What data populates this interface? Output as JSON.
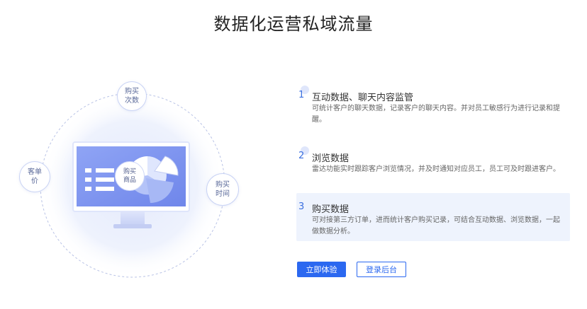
{
  "page": {
    "title": "数据化运营私域流量"
  },
  "illustration": {
    "bubble_top": "购买次数",
    "bubble_left": "客单价",
    "bubble_right": "购买时间",
    "center_label": "购买商品",
    "accent": "#7b95ef"
  },
  "steps": [
    {
      "num": "1",
      "title": "互动数据、聊天内容监管",
      "desc": "可统计客户的聊天数据，记录客户的聊天内容。并对员工敏感行为进行记录和提醒。"
    },
    {
      "num": "2",
      "title": "浏览数据",
      "desc": "雷达功能实时跟踪客户浏览情况，并及时通知对应员工，员工可及时跟进客户。"
    },
    {
      "num": "3",
      "title": "购买数据",
      "desc": "可对接第三方订单，进而统计客户购买记录，可结合互动数据、浏览数据，一起做数据分析。"
    }
  ],
  "buttons": {
    "primary": "立即体验",
    "secondary": "登录后台"
  },
  "colors": {
    "primary": "#2b68f0",
    "active_bg": "#eef3fd"
  }
}
